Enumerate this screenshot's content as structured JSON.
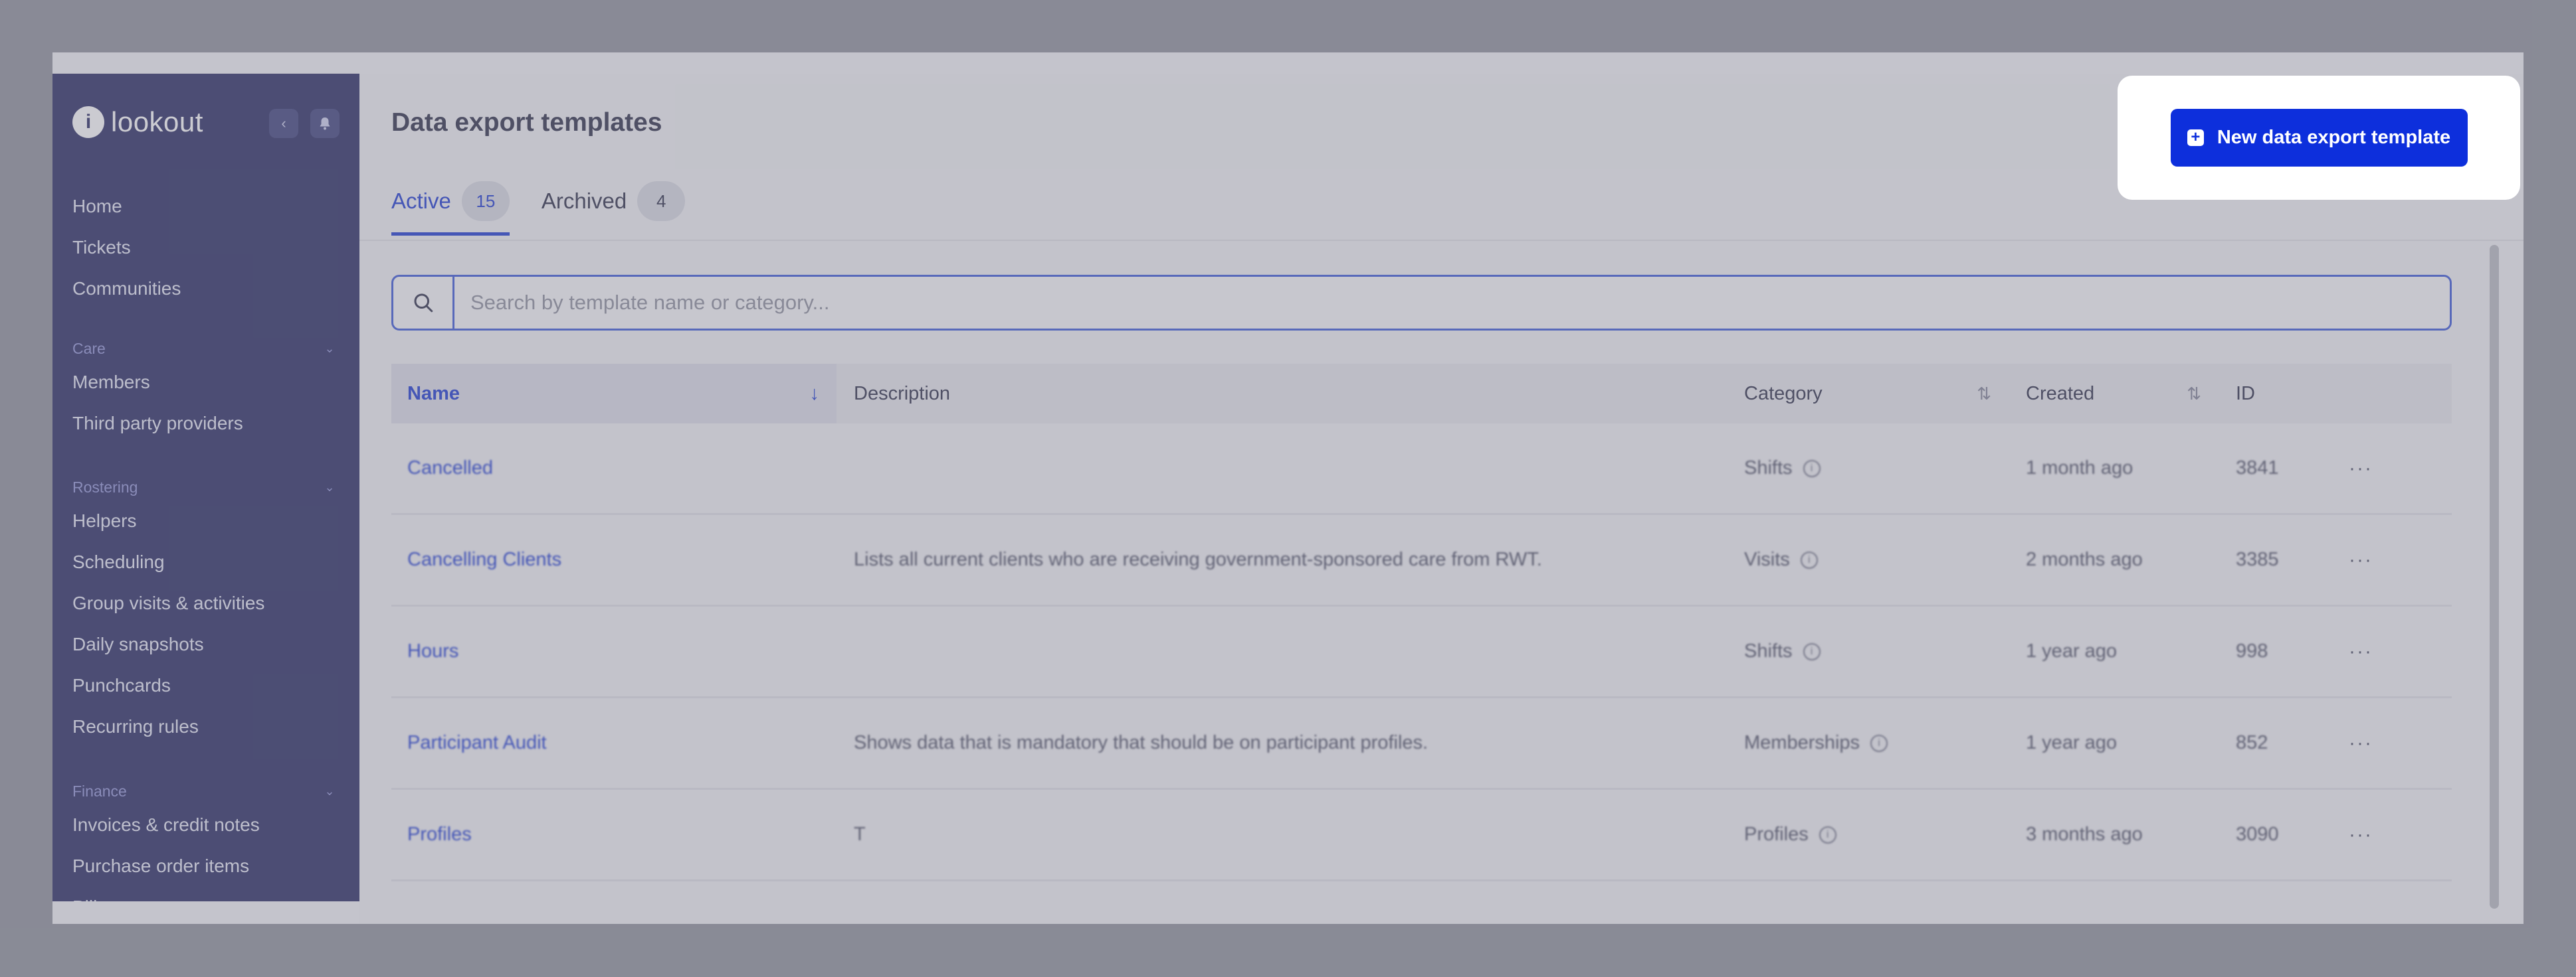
{
  "app": {
    "name": "lookout"
  },
  "sidebar": {
    "top_items": [
      "Home",
      "Tickets",
      "Communities"
    ],
    "sections": [
      {
        "label": "Care",
        "items": [
          "Members",
          "Third party providers"
        ]
      },
      {
        "label": "Rostering",
        "items": [
          "Helpers",
          "Scheduling",
          "Group visits & activities",
          "Daily snapshots",
          "Punchcards",
          "Recurring rules"
        ]
      },
      {
        "label": "Finance",
        "items": [
          "Invoices & credit notes",
          "Purchase order items",
          "Bill..."
        ]
      }
    ]
  },
  "page": {
    "title": "Data export templates",
    "tabs": [
      {
        "label": "Active",
        "count": "15",
        "active": true
      },
      {
        "label": "Archived",
        "count": "4",
        "active": false
      }
    ],
    "search_placeholder": "Search by template name or category...",
    "new_button_label": "New data export template"
  },
  "table": {
    "headers": {
      "name": "Name",
      "description": "Description",
      "category": "Category",
      "created": "Created",
      "id": "ID"
    },
    "rows": [
      {
        "name": "Cancelled",
        "description": "",
        "category": "Shifts",
        "created": "1 month ago",
        "id": "3841"
      },
      {
        "name": "Cancelling Clients",
        "description": "Lists all current clients who are receiving government-sponsored care from RWT.",
        "category": "Visits",
        "created": "2 months ago",
        "id": "3385"
      },
      {
        "name": "Hours",
        "description": "",
        "category": "Shifts",
        "created": "1 year ago",
        "id": "998"
      },
      {
        "name": "Participant Audit",
        "description": "Shows data that is mandatory that should be on participant profiles.",
        "category": "Memberships",
        "created": "1 year ago",
        "id": "852"
      },
      {
        "name": "Profiles",
        "description": "T",
        "category": "Profiles",
        "created": "3 months ago",
        "id": "3090"
      }
    ]
  },
  "colors": {
    "sidebar": "#25275f",
    "accent": "#1936d1",
    "button": "#0d2fdc"
  }
}
